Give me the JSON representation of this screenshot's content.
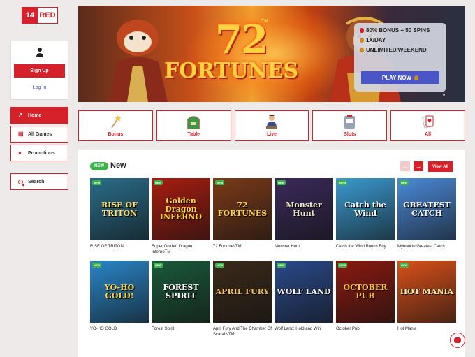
{
  "brand": {
    "num": "14",
    "name": "RED"
  },
  "account": {
    "signup_label": "Sign Up",
    "login_label": "Log In"
  },
  "side_nav": [
    {
      "label": "Home",
      "icon": "trend-icon",
      "active": true
    },
    {
      "label": "All Games",
      "icon": "cards-icon",
      "active": false
    },
    {
      "label": "Promotions",
      "icon": "flame-icon",
      "active": false
    }
  ],
  "search": {
    "label": "Search"
  },
  "banner": {
    "title_number": "72",
    "title_word": "FORTUNES",
    "tm": "TM",
    "offers": [
      "80% BONUS + 50 SPINS",
      "1X/DAY",
      "UNLIMITED/WEEKEND"
    ],
    "cta_label": "PLAY NOW"
  },
  "categories": [
    {
      "label": "Bonus",
      "icon": "wand-icon"
    },
    {
      "label": "Table",
      "icon": "table-icon"
    },
    {
      "label": "Live",
      "icon": "dealer-icon"
    },
    {
      "label": "Slots",
      "icon": "slot-machine-icon"
    },
    {
      "label": "All",
      "icon": "cards-icon"
    }
  ],
  "section": {
    "badge": "NEW",
    "title": "New",
    "view_all_label": "View All",
    "prev_arrow": "←",
    "next_arrow": "→"
  },
  "games": [
    {
      "name": "RISE OF TRITON",
      "art_text": "RISE OF TRITON",
      "bg": "#2a6d8a",
      "fg": "#ffe066",
      "badge": "NEW"
    },
    {
      "name": "Super Golden Dragon InfernoTM",
      "art_text": "Golden Dragon INFERNO",
      "bg": "#a81d10",
      "fg": "#ffd23f",
      "badge": "NEW"
    },
    {
      "name": "72 FortunesTM",
      "art_text": "72 FORTUNES",
      "bg": "#7a3a18",
      "fg": "#ffd23f",
      "badge": "NEW"
    },
    {
      "name": "Monster Hunt",
      "art_text": "Monster Hunt",
      "bg": "#3a2a5a",
      "fg": "#f0e6c8",
      "badge": "NEW"
    },
    {
      "name": "Catch the Wind Bonus Buy",
      "art_text": "Catch the Wind",
      "bg": "#3a9ad0",
      "fg": "#ffffff",
      "badge": "NEW"
    },
    {
      "name": "Mybookie Greatest Catch",
      "art_text": "GREATEST CATCH",
      "bg": "#4a8ad8",
      "fg": "#ffffff",
      "badge": "NEW"
    },
    {
      "name": "YO-HO GOLD",
      "art_text": "YO-HO GOLD!",
      "bg": "#2a86c8",
      "fg": "#ffd23f",
      "badge": "NEW"
    },
    {
      "name": "Forest Spirit",
      "art_text": "FOREST SPIRIT",
      "bg": "#1a5a3a",
      "fg": "#ffffff",
      "badge": "NEW"
    },
    {
      "name": "April Fury And The Chamber Of ScarabsTM",
      "art_text": "APRIL FURY",
      "bg": "#3a2a1a",
      "fg": "#f0c060",
      "badge": "NEW"
    },
    {
      "name": "Wolf Land: Hold and Win",
      "art_text": "WOLF LAND",
      "bg": "#2a4a8a",
      "fg": "#ffffff",
      "badge": "NEW"
    },
    {
      "name": "October Pub",
      "art_text": "OCTOBER PUB",
      "bg": "#8a1a10",
      "fg": "#ffc040",
      "badge": "NEW"
    },
    {
      "name": "Hot Mania",
      "art_text": "HOT MANIA",
      "bg": "#d8501a",
      "fg": "#fff2a0",
      "badge": "NEW"
    }
  ]
}
